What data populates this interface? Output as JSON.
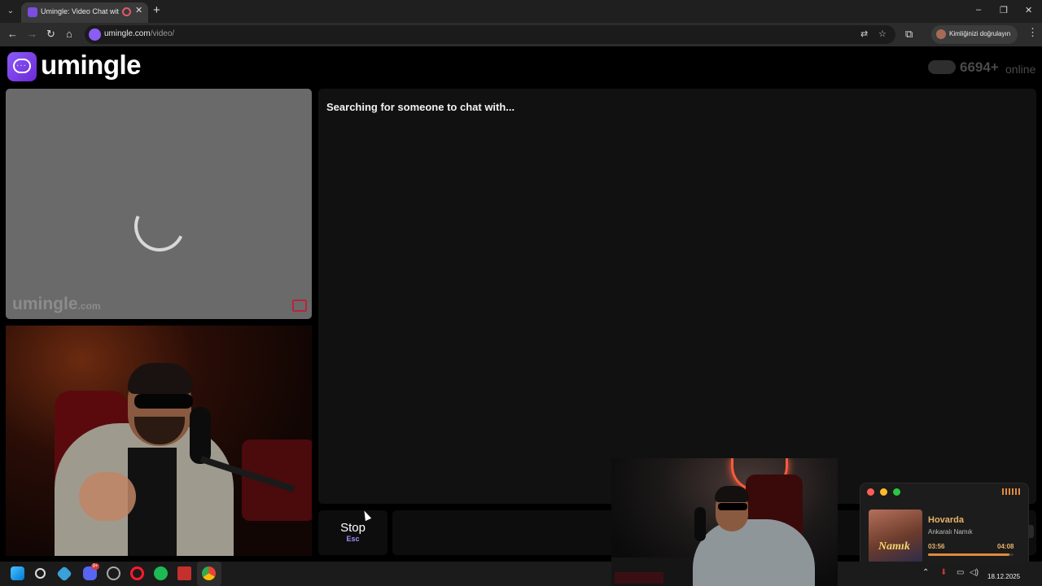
{
  "browser": {
    "tab_title": "Umingle: Video Chat with S",
    "tab_close": "✕",
    "new_tab": "+",
    "url_host": "umingle.com",
    "url_path": "/video/",
    "profile_label": "Kimliğinizi doğrulayın",
    "window_controls": {
      "minimize": "–",
      "restore": "❐",
      "close": "✕"
    }
  },
  "site": {
    "logo_text": "umingle",
    "online_count": "6694+",
    "online_label": "online"
  },
  "stranger": {
    "watermark": "umingle",
    "watermark_suffix": ".com"
  },
  "chat": {
    "status": "Searching for someone to chat with..."
  },
  "controls": {
    "stop_label": "Stop",
    "stop_key": "Esc"
  },
  "music": {
    "title": "Hovarda",
    "artist": "Ankaralı Namık",
    "elapsed": "03:56",
    "total": "04:08",
    "progress": 0.95,
    "album_text": "Namık"
  },
  "taskbar": {
    "discord_badge": "9+",
    "date": "18.12.2025"
  },
  "colors": {
    "brand": "#8b5cf6",
    "accent_orange": "#e08a3c",
    "report_red": "#b9243a"
  }
}
